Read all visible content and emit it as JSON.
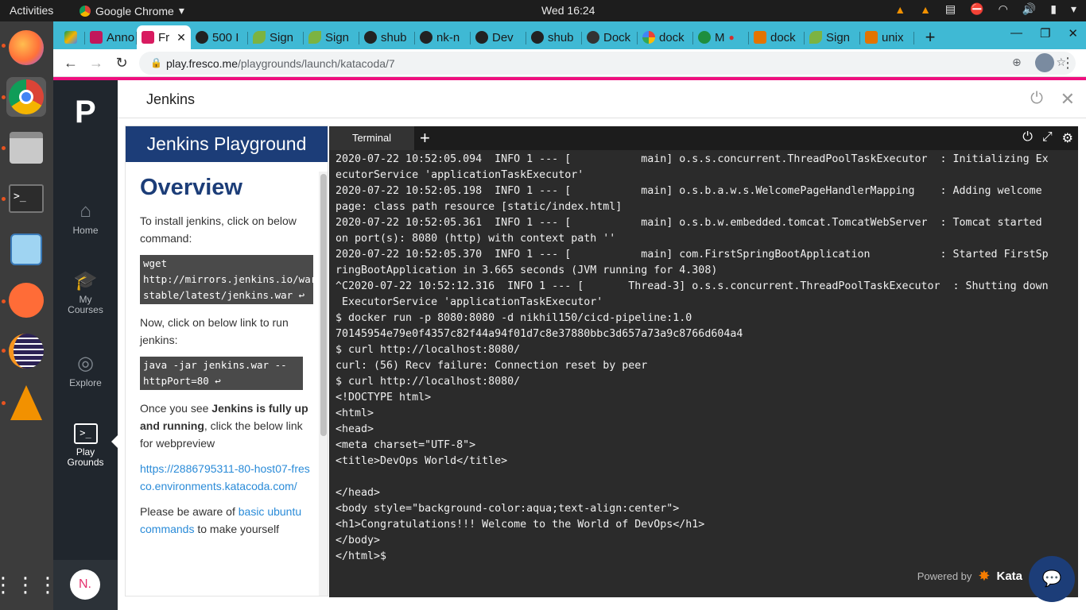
{
  "system_bar": {
    "activities": "Activities",
    "app_name": "Google Chrome",
    "clock": "Wed 16:24"
  },
  "tabs": [
    {
      "label": "",
      "color": "#f4b400"
    },
    {
      "label": "Anno",
      "color": "#c2185b"
    },
    {
      "label": "Fr",
      "color": "#d81b60",
      "active": true
    },
    {
      "label": "500 I",
      "color": "#222"
    },
    {
      "label": "Sign",
      "color": "#7cb342"
    },
    {
      "label": "Sign",
      "color": "#7cb342"
    },
    {
      "label": "shub",
      "color": "#222"
    },
    {
      "label": "nk-n",
      "color": "#222"
    },
    {
      "label": "Dev",
      "color": "#222"
    },
    {
      "label": "shub",
      "color": "#222"
    },
    {
      "label": "Dock",
      "color": "#333"
    },
    {
      "label": "dock",
      "color": "#4285f4"
    },
    {
      "label": "M",
      "color": "#1e8e3e"
    },
    {
      "label": "dock",
      "color": "#e37400"
    },
    {
      "label": "Sign",
      "color": "#7cb342"
    },
    {
      "label": "unix",
      "color": "#e37400"
    }
  ],
  "url": {
    "host": "play.fresco.me",
    "path": "/playgrounds/launch/katacoda/7"
  },
  "sidebar": {
    "logo": "P",
    "items": [
      {
        "label": "Home",
        "icon": "home-icon"
      },
      {
        "label": "My Courses",
        "icon": "graduation-cap-icon"
      },
      {
        "label": "Explore",
        "icon": "compass-icon"
      },
      {
        "label": "Play Grounds",
        "icon": "terminal-icon"
      }
    ],
    "user_initial": "N."
  },
  "header": {
    "title": "Jenkins"
  },
  "guide": {
    "header": "Jenkins Playground",
    "heading": "Overview",
    "p1": "To install jenkins, click on below command:",
    "code1": "wget\nhttp://mirrors.jenkins.io/war-\nstable/latest/jenkins.war ↩",
    "p2": "Now, click on below link to run jenkins:",
    "code2": "java -jar jenkins.war --\nhttpPort=80 ↩",
    "p3a": "Once you see ",
    "p3b": "Jenkins is fully up and running",
    "p3c": ", click the below link for webpreview",
    "link": "https://2886795311-80-host07-fresco.environments.katacoda.com/",
    "p4a": "Please be aware of ",
    "p4link": "basic ubuntu commands",
    "p4b": " to make yourself"
  },
  "terminal": {
    "tab_label": "Terminal",
    "output": "2020-07-22 10:52:05.094  INFO 1 --- [           main] o.s.s.concurrent.ThreadPoolTaskExecutor  : Initializing Ex\necutorService 'applicationTaskExecutor'\n2020-07-22 10:52:05.198  INFO 1 --- [           main] o.s.b.a.w.s.WelcomePageHandlerMapping    : Adding welcome\npage: class path resource [static/index.html]\n2020-07-22 10:52:05.361  INFO 1 --- [           main] o.s.b.w.embedded.tomcat.TomcatWebServer  : Tomcat started\non port(s): 8080 (http) with context path ''\n2020-07-22 10:52:05.370  INFO 1 --- [           main] com.FirstSpringBootApplication           : Started FirstSp\nringBootApplication in 3.665 seconds (JVM running for 4.308)\n^C2020-07-22 10:52:12.316  INFO 1 --- [       Thread-3] o.s.s.concurrent.ThreadPoolTaskExecutor  : Shutting down\n ExecutorService 'applicationTaskExecutor'\n$ docker run -p 8080:8080 -d nikhil150/cicd-pipeline:1.0\n70145954e79e0f4357c82f44a94f01d7c8e37880bbc3d657a73a9c8766d604a4\n$ curl http://localhost:8080/\ncurl: (56) Recv failure: Connection reset by peer\n$ curl http://localhost:8080/\n<!DOCTYPE html>\n<html>\n<head>\n<meta charset=\"UTF-8\">\n<title>DevOps World</title>\n\n</head>\n<body style=\"background-color:aqua;text-align:center\">\n<h1>Congratulations!!! Welcome to the World of DevOps</h1>\n</body>\n</html>$",
    "powered_by": "Powered by",
    "brand": "Kata"
  }
}
